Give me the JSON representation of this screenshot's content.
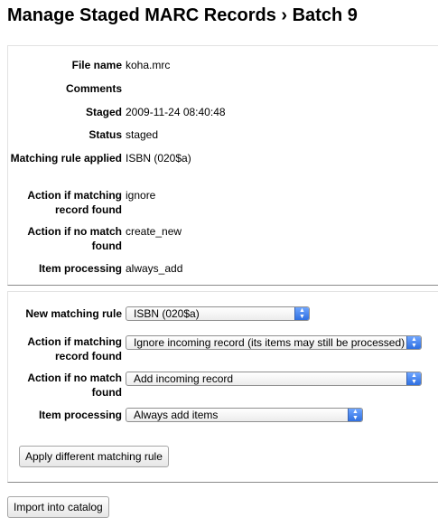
{
  "page": {
    "title": "Manage Staged MARC Records › Batch 9"
  },
  "info": {
    "file_name_label": "File name",
    "file_name": "koha.mrc",
    "comments_label": "Comments",
    "comments": "",
    "staged_label": "Staged",
    "staged": "2009-11-24 08:40:48",
    "status_label": "Status",
    "status": "staged",
    "matching_rule_label": "Matching rule applied",
    "matching_rule": "ISBN (020$a)",
    "action_match_label": "Action if matching record found",
    "action_match": "ignore",
    "action_nomatch_label": "Action if no match found",
    "action_nomatch": "create_new",
    "item_processing_label": "Item processing",
    "item_processing": "always_add"
  },
  "form": {
    "new_rule_label": "New matching rule",
    "new_rule_value": "ISBN (020$a)",
    "action_match_label": "Action if matching record found",
    "action_match_value": "Ignore incoming record (its items may still be processed)",
    "action_nomatch_label": "Action if no match found",
    "action_nomatch_value": "Add incoming record",
    "item_processing_label": "Item processing",
    "item_processing_value": "Always add items",
    "apply_button": "Apply different matching rule"
  },
  "actions": {
    "import_button": "Import into catalog"
  },
  "icons": {
    "select_arrow": "updown-arrows-icon"
  },
  "colors": {
    "select_arrow": "#3b7bea"
  }
}
